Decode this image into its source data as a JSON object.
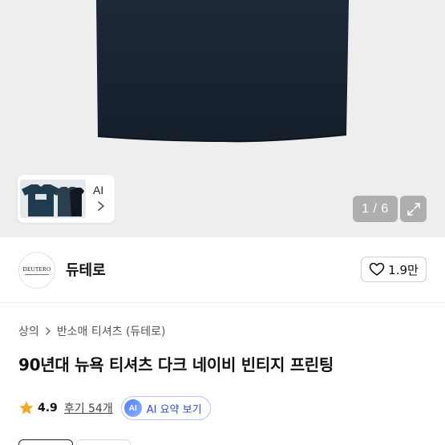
{
  "gallery": {
    "thumbnail_label": "AI",
    "counter": "1 / 6",
    "icons": {
      "thumb_next": "chevron-right-icon",
      "expand": "expand-icon"
    }
  },
  "seller": {
    "logo_text": "DEUTERO",
    "name": "듀테로",
    "like_count": "1.9만",
    "icons": {
      "like": "heart-icon"
    }
  },
  "breadcrumb": {
    "items": [
      "상의",
      "반소매 티셔츠 (듀테로)"
    ],
    "icons": {
      "separator": "chevron-right-icon"
    }
  },
  "product": {
    "title": "90년대 뉴욕 티셔츠 다크 네이비 빈티지 프린팅"
  },
  "rating": {
    "score": "4.9",
    "reviews": "후기 54개",
    "ai_badge": "AI",
    "ai_summary_label": "AI 요약 보기",
    "icons": {
      "star": "star-icon"
    }
  },
  "colors": {
    "shirt_navy": "#1c2736",
    "star": "#f5a623",
    "ai_accent": "#2a4fd6"
  }
}
